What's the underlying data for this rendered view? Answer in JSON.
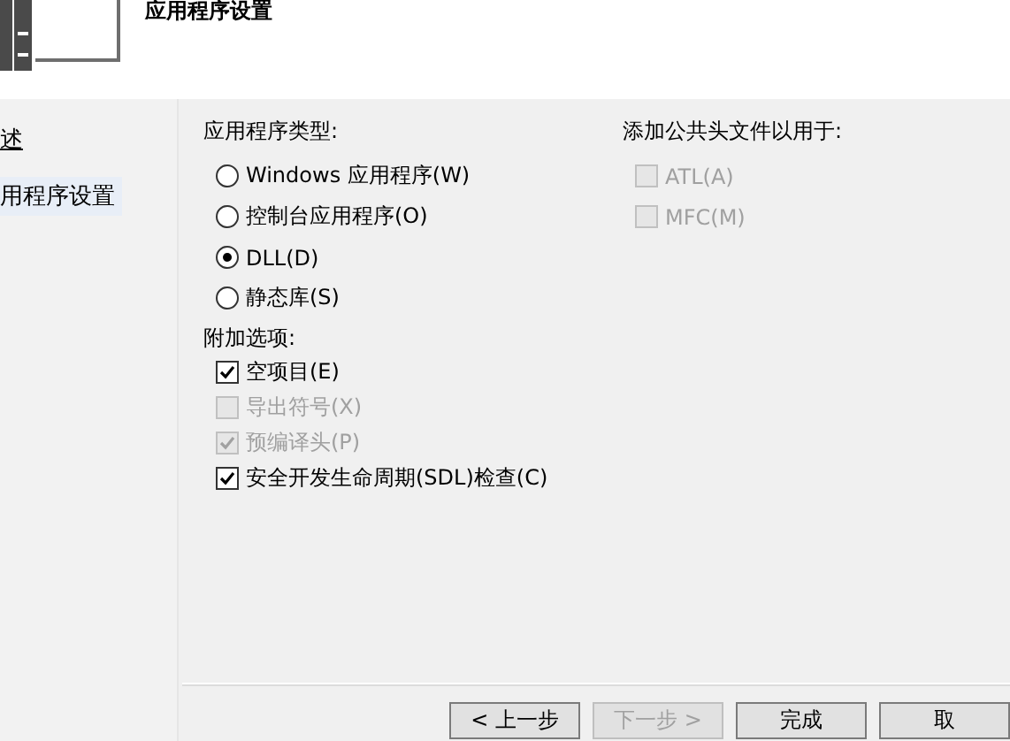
{
  "header": {
    "title": "应用程序设置"
  },
  "sidebar": {
    "items": [
      {
        "label": "述",
        "selected": false
      },
      {
        "label": "用程序设置",
        "selected": true
      }
    ]
  },
  "application_type": {
    "label": "应用程序类型:",
    "options": [
      {
        "label": "Windows 应用程序(W)",
        "selected": false
      },
      {
        "label": "控制台应用程序(O)",
        "selected": false
      },
      {
        "label": "DLL(D)",
        "selected": true
      },
      {
        "label": "静态库(S)",
        "selected": false
      }
    ]
  },
  "additional_options": {
    "label": "附加选项:",
    "options": [
      {
        "label": "空项目(E)",
        "checked": true,
        "disabled": false
      },
      {
        "label": "导出符号(X)",
        "checked": false,
        "disabled": true
      },
      {
        "label": "预编译头(P)",
        "checked": true,
        "disabled": true
      },
      {
        "label": "安全开发生命周期(SDL)检查(C)",
        "checked": true,
        "disabled": false
      }
    ]
  },
  "common_headers": {
    "label": "添加公共头文件以用于:",
    "options": [
      {
        "label": "ATL(A)",
        "checked": false,
        "disabled": true
      },
      {
        "label": "MFC(M)",
        "checked": false,
        "disabled": true
      }
    ]
  },
  "buttons": [
    {
      "label": "< 上一步",
      "disabled": false
    },
    {
      "label": "下一步 >",
      "disabled": true
    },
    {
      "label": "完成",
      "disabled": false
    },
    {
      "label": "取",
      "disabled": false
    }
  ]
}
